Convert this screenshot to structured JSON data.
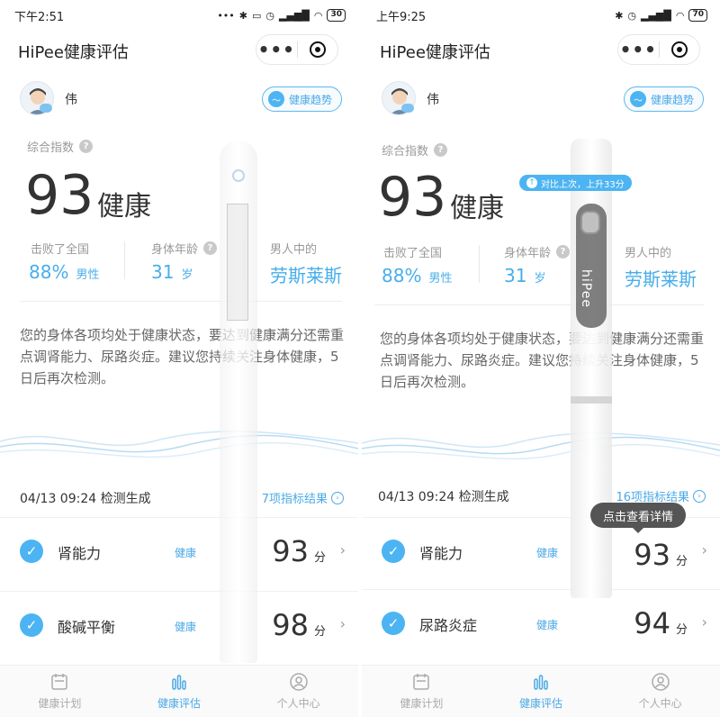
{
  "screens": [
    {
      "status": {
        "time": "下午2:51",
        "battery": "30"
      },
      "app_title": "HiPee健康评估",
      "user": {
        "name": "伟"
      },
      "trend_label": "健康趋势",
      "index": {
        "label": "综合指数",
        "score": "93",
        "word": "健康"
      },
      "stats": {
        "beat": {
          "label": "击败了全国",
          "value": "88%",
          "unit": "男性"
        },
        "age": {
          "label": "身体年龄",
          "value": "31",
          "unit": "岁"
        },
        "rank": {
          "label": "男人中的",
          "value": "劳斯莱斯"
        }
      },
      "description": "您的身体各项均处于健康状态，要达到健康满分还需重点调肾能力、尿路炎症。建议您持续关注身体健康，5日后再次检测。",
      "detect": {
        "time": "04/13 09:24 检测生成",
        "results_link": "7项指标结果"
      },
      "items": [
        {
          "name": "肾能力",
          "status": "健康",
          "score": "93",
          "unit": "分"
        },
        {
          "name": "酸碱平衡",
          "status": "健康",
          "score": "98",
          "unit": "分"
        }
      ]
    },
    {
      "status": {
        "time": "上午9:25",
        "battery": "70"
      },
      "app_title": "HiPee健康评估",
      "user": {
        "name": "伟"
      },
      "trend_label": "健康趋势",
      "compare_chip": "对比上次，上升33分",
      "index": {
        "label": "综合指数",
        "score": "93",
        "word": "健康"
      },
      "stats": {
        "beat": {
          "label": "击败了全国",
          "value": "88%",
          "unit": "男性"
        },
        "age": {
          "label": "身体年龄",
          "value": "31",
          "unit": "岁"
        },
        "rank": {
          "label": "男人中的",
          "value": "劳斯莱斯"
        }
      },
      "description": "您的身体各项均处于健康状态，要达到健康满分还需重点调肾能力、尿路炎症。建议您持续关注身体健康，5日后再次检测。",
      "detect": {
        "time": "04/13 09:24 检测生成",
        "results_link": "16项指标结果"
      },
      "tooltip": "点击查看详情",
      "pen_brand": "hiPee",
      "items": [
        {
          "name": "肾能力",
          "status": "健康",
          "score": "93",
          "unit": "分"
        },
        {
          "name": "尿路炎症",
          "status": "健康",
          "score": "94",
          "unit": "分"
        }
      ]
    }
  ],
  "tabs": [
    {
      "label": "健康计划",
      "icon": "calendar-icon"
    },
    {
      "label": "健康评估",
      "icon": "bar-chart-icon"
    },
    {
      "label": "个人中心",
      "icon": "person-icon"
    }
  ],
  "colors": {
    "accent": "#4cb4f2",
    "text": "#333333",
    "muted": "#999999"
  }
}
